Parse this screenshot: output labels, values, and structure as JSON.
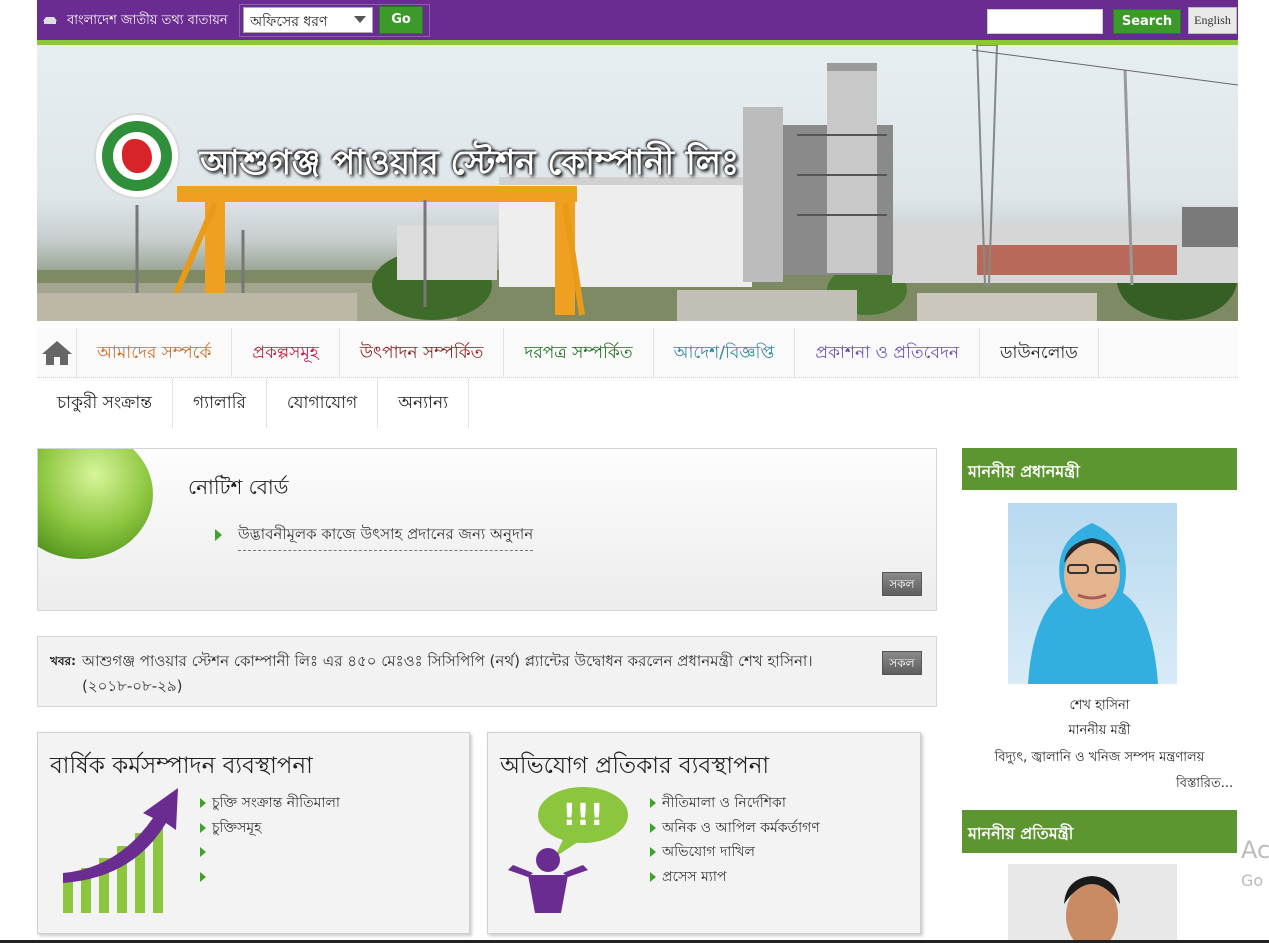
{
  "topbar": {
    "portal_label": "বাংলাদেশ জাতীয় তথ্য বাতায়ন",
    "office_select": "অফিসের ধরণ",
    "go_label": "Go",
    "search_placeholder": "",
    "search_label": "Search",
    "language_label": "English"
  },
  "banner": {
    "site_title": "আশুগঞ্জ পাওয়ার স্টেশন কোম্পানী লিঃ"
  },
  "nav": {
    "row1": [
      {
        "label": "আমাদের সম্পর্কে",
        "color": "#d2691e"
      },
      {
        "label": "প্রকল্পসমূহ",
        "color": "#c0143c"
      },
      {
        "label": "উৎপাদন সম্পর্কিত",
        "color": "#8b1a1a"
      },
      {
        "label": "দরপত্র সম্পর্কিত",
        "color": "#1f6b1f"
      },
      {
        "label": "আদেশ/বিজ্ঞপ্তি",
        "color": "#2a8a9a"
      },
      {
        "label": "প্রকাশনা ও প্রতিবেদন",
        "color": "#6a4fb3"
      },
      {
        "label": "ডাউনলোড",
        "color": "#222222"
      }
    ],
    "row2": [
      {
        "label": "চাকুরী সংক্রান্ত"
      },
      {
        "label": "গ্যালারি"
      },
      {
        "label": "যোগাযোগ"
      },
      {
        "label": "অন্যান্য"
      }
    ]
  },
  "notice": {
    "title": "নোটিশ বোর্ড",
    "item": "উদ্ভাবনীমূলক কাজে উৎসাহ প্রদানের জন্য অনুদান",
    "all_label": "সকল"
  },
  "news": {
    "label": "খবর:",
    "text": "আশুগঞ্জ পাওয়ার স্টেশন কোম্পানী লিঃ এর ৪৫০ মেঃওঃ সিসিপিপি (নর্থ) প্ল্যান্টের উদ্বোধন করলেন প্রধানমন্ত্রী শেখ হাসিনা। (২০১৮-০৮-২৯)",
    "all_label": "সকল"
  },
  "apa": {
    "title": "বার্ষিক কর্মসম্পাদন ব্যবস্থাপনা",
    "items": [
      "চুক্তি সংক্রান্ত নীতিমালা",
      "চুক্তিসমূহ",
      "",
      ""
    ]
  },
  "grs": {
    "title": "অভিযোগ প্রতিকার ব্যবস্থাপনা",
    "items": [
      "নীতিমালা ও নির্দেশিকা",
      "অনিক ও আপিল কর্মকর্তাগণ",
      "অভিযোগ দাখিল",
      "প্রসেস ম্যাপ"
    ]
  },
  "sidebar": {
    "pm_heading": "মাননীয় প্রধানমন্ত্রী",
    "pm_name": "শেখ হাসিনা",
    "pm_role": "মাননীয় মন্ত্রী",
    "pm_ministry": "বিদ্যুৎ, জ্বালানি ও খনিজ সম্পদ মন্ত্রণালয়",
    "more_label": "বিস্তারিত...",
    "sm_heading": "মাননীয় প্রতিমন্ত্রী"
  },
  "watermark": {
    "line1": "Ac",
    "line2": "Go"
  },
  "colors": {
    "topbar": "#6b2c91",
    "accent_green": "#8cc63f",
    "button_green": "#3c9a2a",
    "sidebar_heading": "#5d9630"
  }
}
